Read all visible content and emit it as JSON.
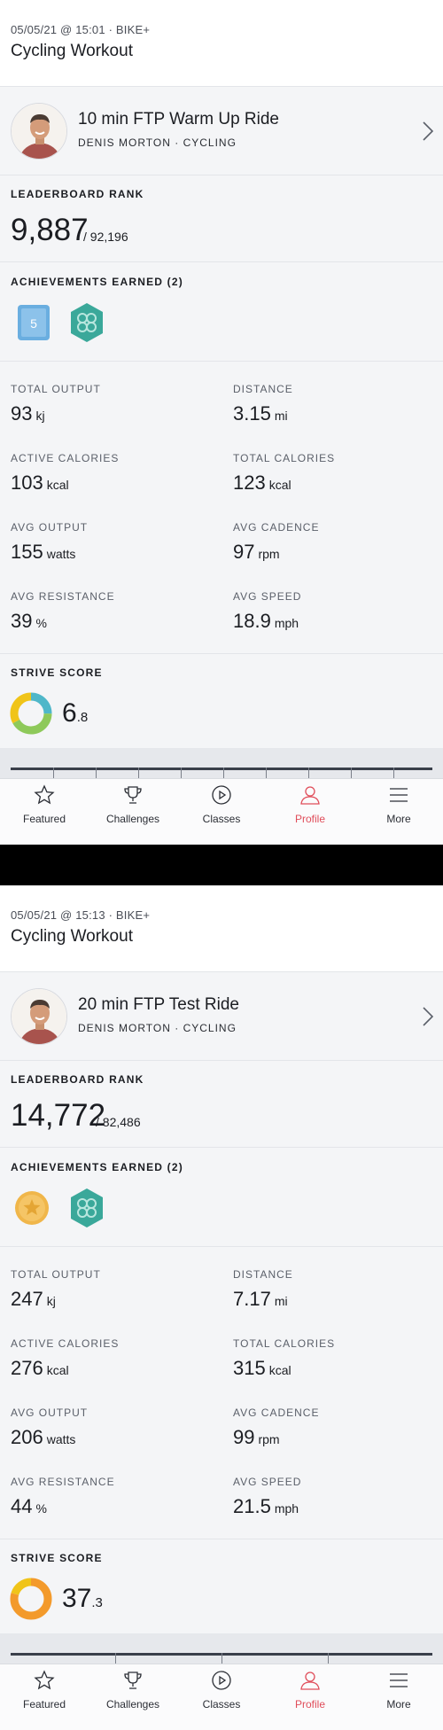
{
  "workouts": [
    {
      "header": {
        "meta": "05/05/21 @ 15:01  ·  BIKE+",
        "title": "Cycling Workout"
      },
      "class": {
        "title": "10 min FTP Warm Up Ride",
        "subtitle": "DENIS MORTON  ·  CYCLING"
      },
      "leaderboard": {
        "label": "LEADERBOARD RANK",
        "rank": "9,887",
        "total": "/ 92,196"
      },
      "achievements": {
        "label": "ACHIEVEMENTS EARNED (2)",
        "badges": [
          "streak-5-badge-icon",
          "hexagon-badge-icon"
        ],
        "badge_text": "5"
      },
      "metrics": [
        {
          "label": "TOTAL OUTPUT",
          "value": "93",
          "unit": "kj"
        },
        {
          "label": "DISTANCE",
          "value": "3.15",
          "unit": "mi"
        },
        {
          "label": "ACTIVE CALORIES",
          "value": "103",
          "unit": "kcal"
        },
        {
          "label": "TOTAL CALORIES",
          "value": "123",
          "unit": "kcal"
        },
        {
          "label": "AVG OUTPUT",
          "value": "155",
          "unit": "watts"
        },
        {
          "label": "AVG CADENCE",
          "value": "97",
          "unit": "rpm"
        },
        {
          "label": "AVG RESISTANCE",
          "value": "39",
          "unit": "%"
        },
        {
          "label": "AVG SPEED",
          "value": "18.9",
          "unit": "mph"
        }
      ],
      "strive": {
        "label": "STRIVE SCORE",
        "value": "6",
        "decimal": ".8"
      }
    },
    {
      "header": {
        "meta": "05/05/21 @ 15:13  ·  BIKE+",
        "title": "Cycling Workout"
      },
      "class": {
        "title": "20 min FTP Test Ride",
        "subtitle": "DENIS MORTON  ·  CYCLING"
      },
      "leaderboard": {
        "label": "LEADERBOARD RANK",
        "rank": "14,772",
        "total": "/ 82,486"
      },
      "achievements": {
        "label": "ACHIEVEMENTS EARNED (2)",
        "badges": [
          "gold-medal-badge-icon",
          "hexagon-badge-icon"
        ]
      },
      "metrics": [
        {
          "label": "TOTAL OUTPUT",
          "value": "247",
          "unit": "kj"
        },
        {
          "label": "DISTANCE",
          "value": "7.17",
          "unit": "mi"
        },
        {
          "label": "ACTIVE CALORIES",
          "value": "276",
          "unit": "kcal"
        },
        {
          "label": "TOTAL CALORIES",
          "value": "315",
          "unit": "kcal"
        },
        {
          "label": "AVG OUTPUT",
          "value": "206",
          "unit": "watts"
        },
        {
          "label": "AVG CADENCE",
          "value": "99",
          "unit": "rpm"
        },
        {
          "label": "AVG RESISTANCE",
          "value": "44",
          "unit": "%"
        },
        {
          "label": "AVG SPEED",
          "value": "21.5",
          "unit": "mph"
        }
      ],
      "strive": {
        "label": "STRIVE SCORE",
        "value": "37",
        "decimal": ".3"
      }
    }
  ],
  "tabbar": {
    "featured": "Featured",
    "challenges": "Challenges",
    "classes": "Classes",
    "profile": "Profile",
    "more": "More",
    "active": "profile"
  },
  "colors": {
    "accent_active": "#e04d5a",
    "strive_zone_1": "#4fb7c9",
    "strive_zone_2": "#8ec95a",
    "strive_zone_3": "#f0c419",
    "strive_zone_4": "#f39a2b",
    "badge_blue": "#6aaee0",
    "badge_teal": "#3aa89a",
    "badge_gold": "#f0b64a"
  }
}
